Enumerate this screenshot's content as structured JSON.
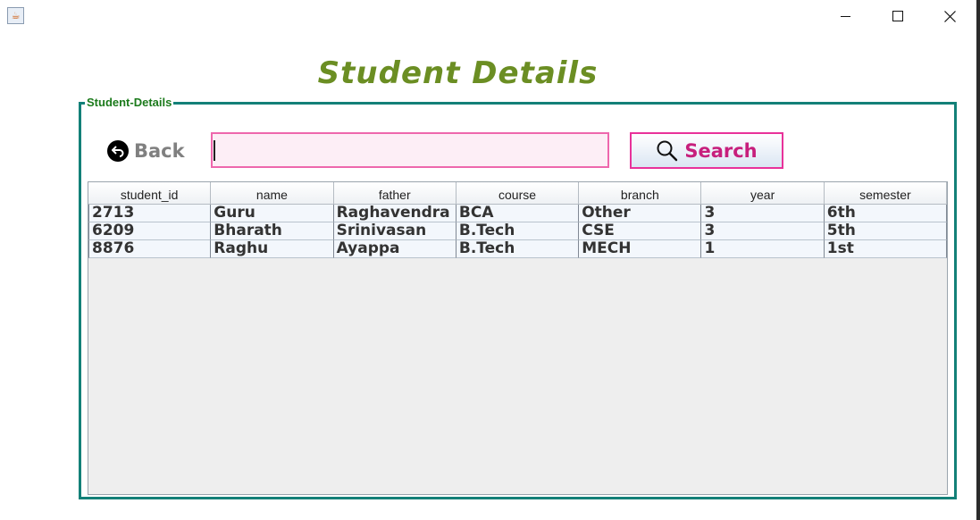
{
  "window": {
    "minimize_symbol": "—",
    "close_symbol": "✕"
  },
  "title": "Student Details",
  "group_label": "Student-Details",
  "back": {
    "label": "Back",
    "icon": "back-arrow-icon"
  },
  "search": {
    "input_value": "",
    "button_label": "Search",
    "icon": "magnifier-icon"
  },
  "table": {
    "columns": [
      "student_id",
      "name",
      "father",
      "course",
      "branch",
      "year",
      "semester"
    ],
    "rows": [
      [
        "2713",
        "Guru",
        "Raghavendra",
        "BCA",
        "Other",
        "3",
        "6th"
      ],
      [
        "6209",
        "Bharath",
        "Srinivasan",
        "B.Tech",
        "CSE",
        "3",
        "5th"
      ],
      [
        "8876",
        "Raghu",
        "Ayappa",
        "B.Tech",
        "MECH",
        "1",
        "1st"
      ]
    ]
  },
  "colors": {
    "title": "#6b8e23",
    "group_border": "#138078",
    "search_border": "#e8329a",
    "search_text": "#c71f7c"
  }
}
